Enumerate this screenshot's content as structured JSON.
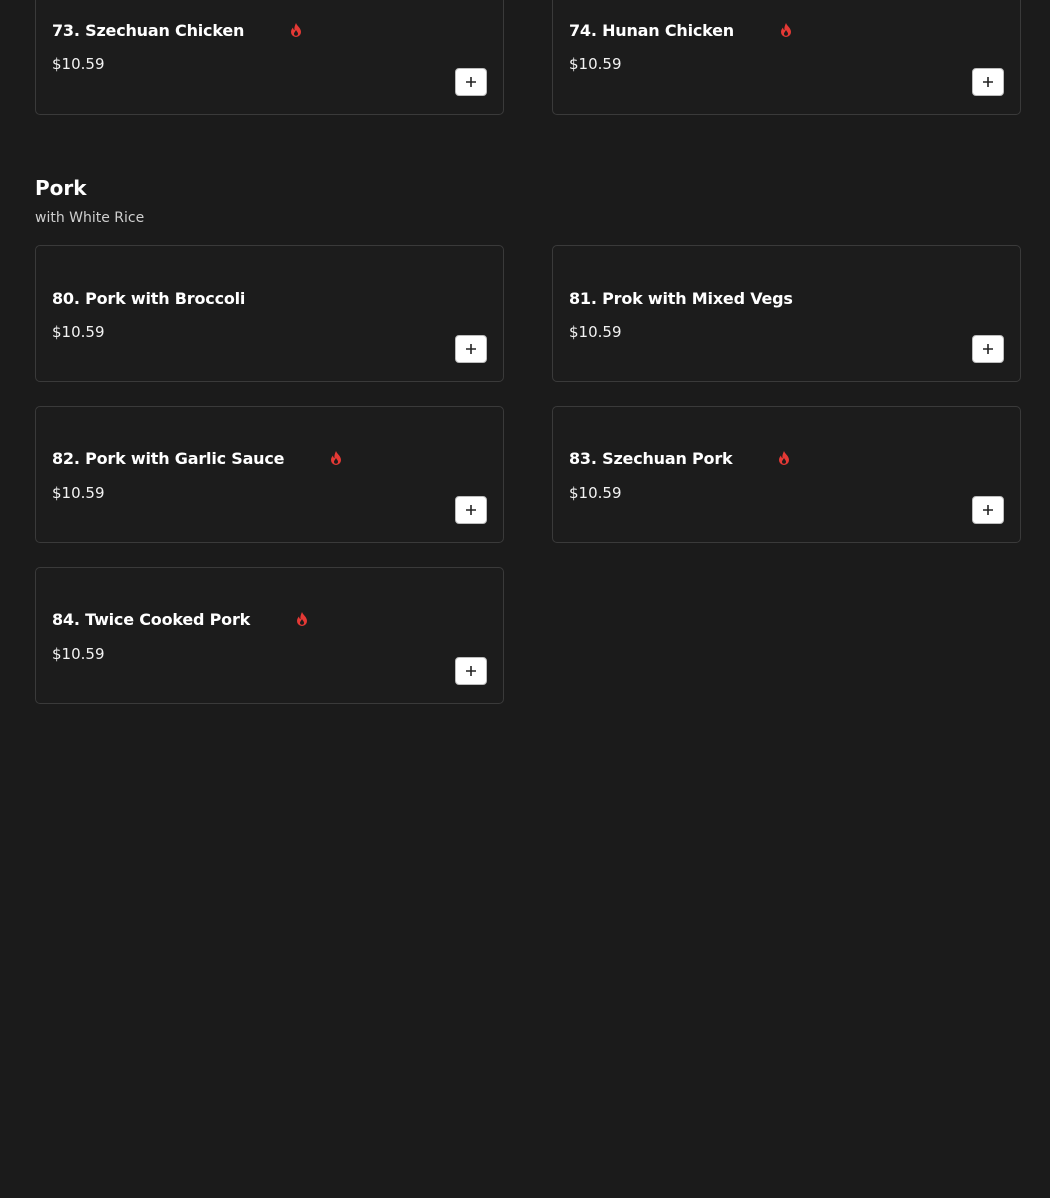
{
  "colors": {
    "background": "#1b1b1b",
    "card_border": "#3a3a3a",
    "spicy_icon": "#e53935",
    "add_button_bg": "#ffffff"
  },
  "icons": {
    "spicy": "spicy-flame-icon",
    "add": "plus-icon"
  },
  "chicken_items": [
    {
      "name": "73. Szechuan Chicken",
      "price": "$10.59",
      "spicy": true
    },
    {
      "name": "74. Hunan Chicken",
      "price": "$10.59",
      "spicy": true
    }
  ],
  "pork_section": {
    "title": "Pork",
    "subtitle": "with White Rice",
    "items": [
      {
        "name": "80. Pork with Broccoli",
        "price": "$10.59",
        "spicy": false
      },
      {
        "name": "81. Prok with Mixed Vegs",
        "price": "$10.59",
        "spicy": false
      },
      {
        "name": "82. Pork with Garlic Sauce",
        "price": "$10.59",
        "spicy": true
      },
      {
        "name": "83. Szechuan Pork",
        "price": "$10.59",
        "spicy": true
      },
      {
        "name": "84. Twice Cooked Pork",
        "price": "$10.59",
        "spicy": true
      }
    ]
  }
}
